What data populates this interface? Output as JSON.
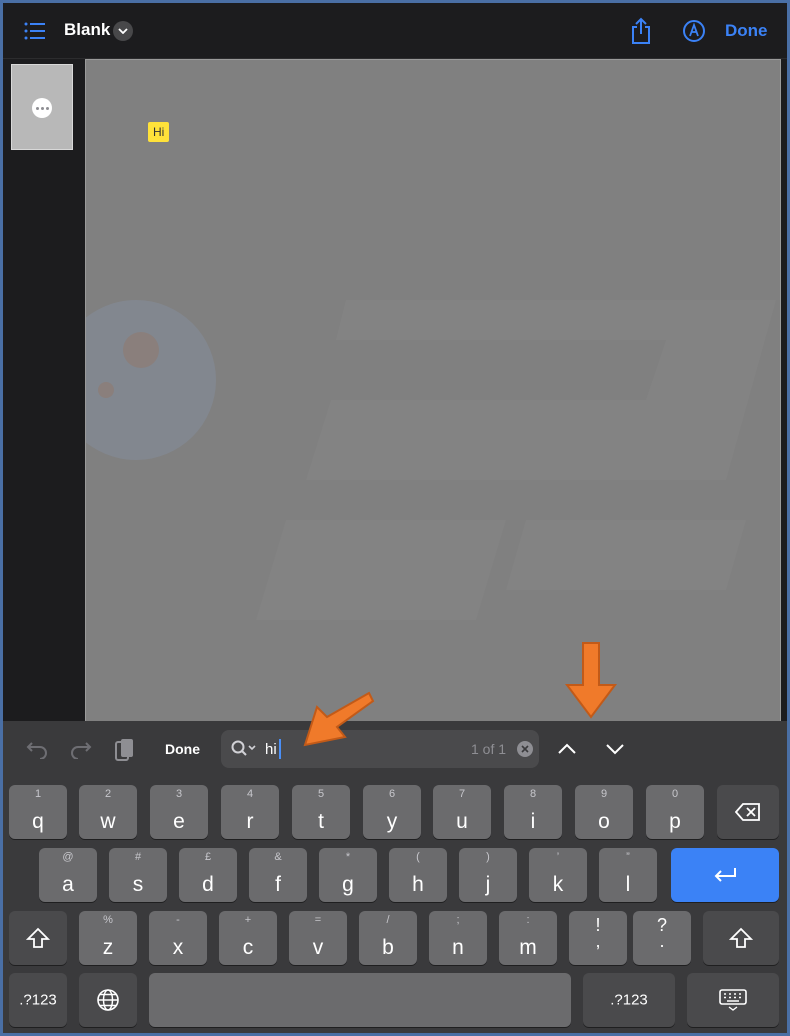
{
  "header": {
    "title": "Blank",
    "done_label": "Done"
  },
  "canvas": {
    "note_text": "Hi"
  },
  "findbar": {
    "done_label": "Done",
    "search_value": "hi",
    "match_count": "1 of 1"
  },
  "keyboard": {
    "row1": [
      {
        "sub": "1",
        "main": "q"
      },
      {
        "sub": "2",
        "main": "w"
      },
      {
        "sub": "3",
        "main": "e"
      },
      {
        "sub": "4",
        "main": "r"
      },
      {
        "sub": "5",
        "main": "t"
      },
      {
        "sub": "6",
        "main": "y"
      },
      {
        "sub": "7",
        "main": "u"
      },
      {
        "sub": "8",
        "main": "i"
      },
      {
        "sub": "9",
        "main": "o"
      },
      {
        "sub": "0",
        "main": "p"
      }
    ],
    "row2": [
      {
        "sub": "@",
        "main": "a"
      },
      {
        "sub": "#",
        "main": "s"
      },
      {
        "sub": "£",
        "main": "d"
      },
      {
        "sub": "&",
        "main": "f"
      },
      {
        "sub": "*",
        "main": "g"
      },
      {
        "sub": "(",
        "main": "h"
      },
      {
        "sub": ")",
        "main": "j"
      },
      {
        "sub": "’",
        "main": "k"
      },
      {
        "sub": "”",
        "main": "l"
      }
    ],
    "row3": [
      {
        "sub": "%",
        "main": "z"
      },
      {
        "sub": "-",
        "main": "x"
      },
      {
        "sub": "+",
        "main": "c"
      },
      {
        "sub": "=",
        "main": "v"
      },
      {
        "sub": "/",
        "main": "b"
      },
      {
        "sub": ";",
        "main": "n"
      },
      {
        "sub": ":",
        "main": "m"
      }
    ],
    "row3_punct": [
      {
        "top": "!",
        "bottom": ","
      },
      {
        "top": "?",
        "bottom": "."
      }
    ],
    "numbers_label": ".?123"
  },
  "colors": {
    "accent": "#3b82f6",
    "highlight": "#ffe23a",
    "annotation_arrow": "#f07a2a"
  }
}
